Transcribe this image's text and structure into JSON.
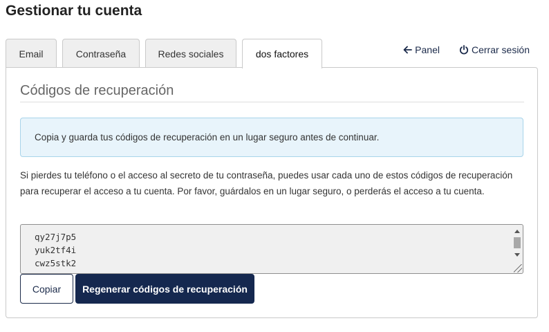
{
  "page": {
    "title": "Gestionar tu cuenta"
  },
  "tabs": [
    {
      "label": "Email",
      "active": false
    },
    {
      "label": "Contraseña",
      "active": false
    },
    {
      "label": "Redes sociales",
      "active": false
    },
    {
      "label": "dos factores",
      "active": true
    }
  ],
  "top_links": {
    "panel": {
      "label": "Panel",
      "icon": "arrow-left-icon"
    },
    "logout": {
      "label": "Cerrar sesión",
      "icon": "power-icon"
    }
  },
  "section": {
    "heading": "Códigos de recuperación",
    "alert": "Copia y guarda tus códigos de recuperación en un lugar seguro antes de continuar.",
    "description": "Si pierdes tu teléfono o el acceso al secreto de tu contraseña, puedes usar cada uno de estos códigos de recuperación para recuperar el acceso a tu cuenta. Por favor, guárdalos en un lugar seguro, o perderás el acceso a tu cuenta."
  },
  "recovery_codes": [
    "qy27j7p5",
    "yuk2tf4i",
    "cwz5stk2"
  ],
  "buttons": {
    "copy": "Copiar",
    "regenerate": "Regenerar códigos de recuperación"
  },
  "colors": {
    "primary": "#15284f",
    "alert_bg": "#e8f4fb",
    "alert_border": "#a8d4ea"
  }
}
